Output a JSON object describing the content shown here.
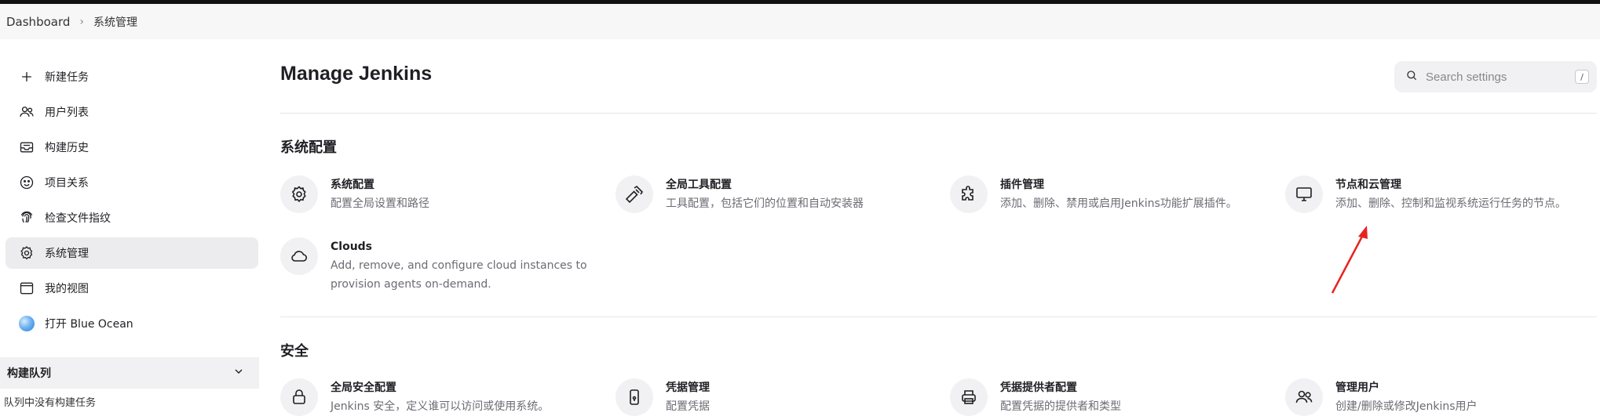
{
  "breadcrumb": {
    "home": "Dashboard",
    "current": "系统管理"
  },
  "sidebar": {
    "items": [
      {
        "label": "新建任务",
        "icon": "plus-icon"
      },
      {
        "label": "用户列表",
        "icon": "people-icon"
      },
      {
        "label": "构建历史",
        "icon": "inbox-icon"
      },
      {
        "label": "项目关系",
        "icon": "smiley-icon"
      },
      {
        "label": "检查文件指纹",
        "icon": "fingerprint-icon"
      },
      {
        "label": "系统管理",
        "icon": "gear-icon",
        "active": true
      },
      {
        "label": "我的视图",
        "icon": "window-icon"
      },
      {
        "label": "打开 Blue Ocean",
        "icon": "blue-ocean-icon"
      }
    ]
  },
  "queue": {
    "title": "构建队列",
    "empty_text": "队列中没有构建任务"
  },
  "main": {
    "title": "Manage Jenkins",
    "search": {
      "placeholder": "Search settings",
      "shortcut": "/"
    },
    "sections": [
      {
        "title": "系统配置",
        "cards": [
          {
            "title": "系统配置",
            "desc": "配置全局设置和路径",
            "icon": "gear-icon"
          },
          {
            "title": "全局工具配置",
            "desc": "工具配置，包括它们的位置和自动安装器",
            "icon": "hammer-icon"
          },
          {
            "title": "插件管理",
            "desc": "添加、删除、禁用或启用Jenkins功能扩展插件。",
            "icon": "puzzle-icon"
          },
          {
            "title": "节点和云管理",
            "desc": "添加、删除、控制和监视系统运行任务的节点。",
            "icon": "monitor-icon"
          },
          {
            "title": "Clouds",
            "desc": "Add, remove, and configure cloud instances to provision agents on-demand.",
            "icon": "cloud-icon"
          }
        ]
      },
      {
        "title": "安全",
        "cards": [
          {
            "title": "全局安全配置",
            "desc": "Jenkins 安全，定义谁可以访问或使用系统。",
            "icon": "lock-icon"
          },
          {
            "title": "凭据管理",
            "desc": "配置凭据",
            "icon": "phone-icon"
          },
          {
            "title": "凭据提供者配置",
            "desc": "配置凭据的提供者和类型",
            "icon": "printer-icon"
          },
          {
            "title": "管理用户",
            "desc": "创建/删除或修改Jenkins用户",
            "icon": "people-icon"
          }
        ]
      }
    ]
  },
  "annotation_color": "#e8231f"
}
